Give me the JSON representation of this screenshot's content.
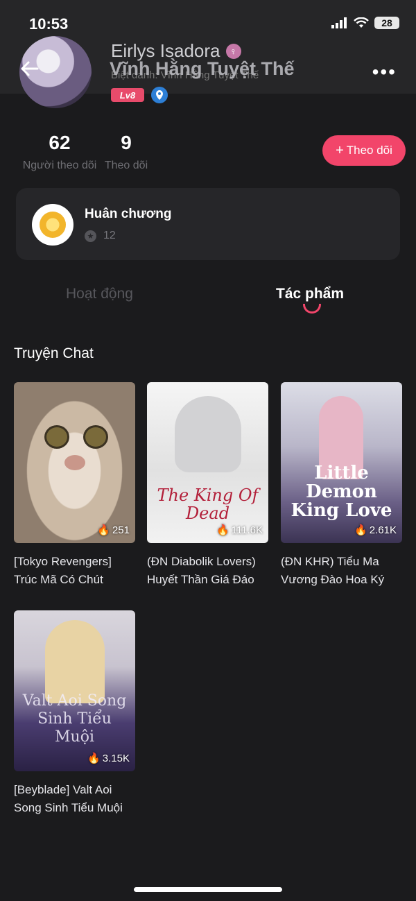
{
  "status": {
    "time": "10:53",
    "battery": "28"
  },
  "profile": {
    "name": "Eirlys Isadora",
    "gender_symbol": "♀",
    "nickname": "Vĩnh Hằng Tuyệt Thế",
    "nickname_subtitle": "Biệt danh: Vĩnh Hằng Tuyệt Thế",
    "level": "Lv8",
    "followers": {
      "value": "62",
      "label": "Người theo dõi"
    },
    "following": {
      "value": "9",
      "label": "Theo dõi"
    },
    "follow_button": "Theo dõi"
  },
  "medal": {
    "title": "Huân chương",
    "count": "12"
  },
  "tabs": [
    {
      "label": "Hoạt động",
      "active": false
    },
    {
      "label": "Tác phẩm",
      "active": true
    }
  ],
  "section_title": "Truyện Chat",
  "works": [
    {
      "title": "[Tokyo Revengers]\nTrúc Mã Có Chút",
      "views": "251",
      "cover_text": ""
    },
    {
      "title": "(ĐN Diabolik Lovers)\nHuyết Thần Giá Đáo",
      "views": "111.6K",
      "cover_text": "The King Of Dead"
    },
    {
      "title": "(ĐN KHR) Tiểu Ma\nVương Đào Hoa Ký",
      "views": "2.61K",
      "cover_text": "Little Demon King Love"
    },
    {
      "title": "[Beyblade] Valt Aoi\nSong Sinh Tiểu Muội",
      "views": "3.15K",
      "cover_text": "Valt Aoi Song Sinh Tiểu Muội"
    }
  ],
  "colors": {
    "accent": "#f2456a",
    "background": "#1b1b1d",
    "card": "#262629"
  }
}
